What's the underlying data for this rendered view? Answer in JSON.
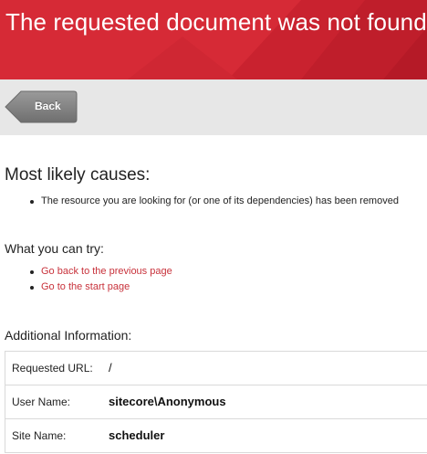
{
  "header": {
    "title": "The requested document was not found",
    "color": "#d62a36"
  },
  "toolbar": {
    "back_label": "Back"
  },
  "causes": {
    "heading": "Most likely causes:",
    "items": [
      "The resource you are looking for (or one of its dependencies) has been removed"
    ]
  },
  "try": {
    "heading": "What you can try:",
    "links": [
      "Go back to the previous page",
      "Go to the start page"
    ],
    "link_color": "#c8323b"
  },
  "additional": {
    "heading": "Additional Information:",
    "rows": [
      {
        "label": "Requested URL:",
        "value": "/"
      },
      {
        "label": "User Name:",
        "value": "sitecore\\Anonymous"
      },
      {
        "label": "Site Name:",
        "value": "scheduler"
      }
    ]
  }
}
